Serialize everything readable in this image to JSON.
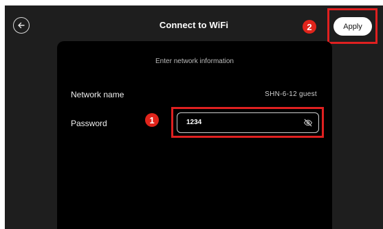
{
  "header": {
    "title": "Connect to WiFi",
    "back_icon": "arrow-left-circle-icon",
    "apply_label": "Apply"
  },
  "form": {
    "heading": "Enter network information",
    "network_name_label": "Network name",
    "network_name_value": "SHN-6-12 guest",
    "password_label": "Password",
    "password_value": "1234",
    "visibility_icon": "eye-slash-icon"
  },
  "annotations": {
    "marker_1": "1",
    "marker_2": "2",
    "highlight_color": "#e02020"
  },
  "colors": {
    "background": "#1e1e1e",
    "panel": "#000000",
    "apply_button": "#ffffff"
  }
}
